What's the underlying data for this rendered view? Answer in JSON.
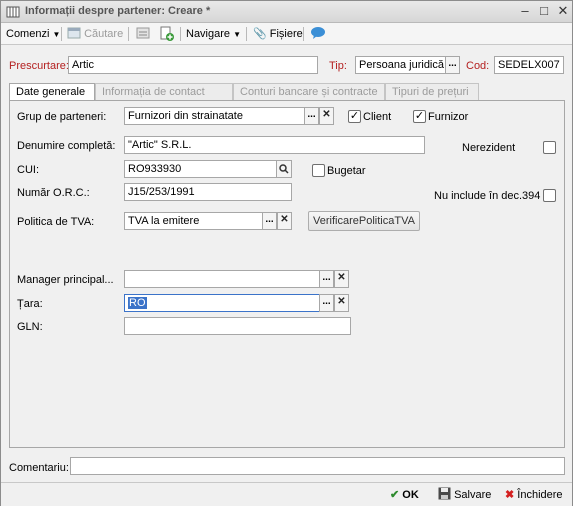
{
  "window": {
    "title": "Informații despre partener: Creare *"
  },
  "toolbar": {
    "comenzi": "Comenzi",
    "cautare": "Căutare",
    "navigare": "Navigare",
    "fisiere": "Fișiere"
  },
  "header": {
    "prescurtare_label": "Prescurtare:",
    "prescurtare_value": "Artic",
    "tip_label": "Tip:",
    "tip_value": "Persoana juridică",
    "cod_label": "Cod:",
    "cod_value": "SEDELX007"
  },
  "tabs": [
    {
      "label": "Date generale",
      "active": true
    },
    {
      "label": "Informația de contact",
      "active": false
    },
    {
      "label": "Conturi bancare și contracte",
      "active": false
    },
    {
      "label": "Tipuri de prețuri",
      "active": false
    }
  ],
  "form": {
    "grup_label": "Grup de parteneri:",
    "grup_value": "Furnizori din strainatate",
    "client_label": "Client",
    "client_checked": true,
    "furnizor_label": "Furnizor",
    "furnizor_checked": true,
    "denumire_label": "Denumire completă:",
    "denumire_value": "\"Artic\" S.R.L.",
    "nerezident_label": "Nerezident",
    "nerezident_checked": false,
    "cui_label": "CUI:",
    "cui_value": "RO933930",
    "bugetar_label": "Bugetar",
    "bugetar_checked": false,
    "orc_label": "Număr O.R.C.:",
    "orc_value": "J15/253/1991",
    "nu_include_label": "Nu include în dec.394",
    "nu_include_checked": false,
    "tva_label": "Politica de TVA:",
    "tva_value": "TVA la emitere",
    "verificare_button": "VerificarePoliticaTVA",
    "manager_label": "Manager principal...",
    "manager_value": "",
    "tara_label": "Țara:",
    "tara_value": "RO",
    "gln_label": "GLN:",
    "gln_value": ""
  },
  "footer": {
    "comentariu_label": "Comentariu:",
    "comentariu_value": "",
    "ok": "OK",
    "salvare": "Salvare",
    "inchidere": "Închidere"
  }
}
